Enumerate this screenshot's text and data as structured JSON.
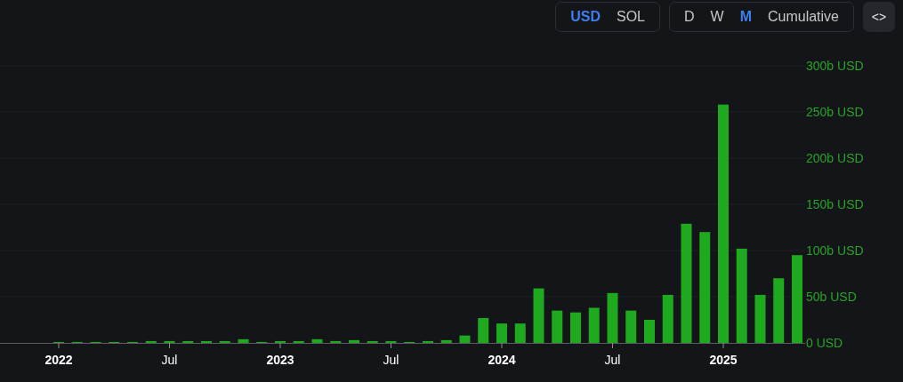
{
  "currency_toggle": [
    {
      "label": "USD",
      "selected": true
    },
    {
      "label": "SOL",
      "selected": false
    }
  ],
  "period_toggle": [
    {
      "label": "D",
      "selected": false
    },
    {
      "label": "W",
      "selected": false
    },
    {
      "label": "M",
      "selected": true
    },
    {
      "label": "Cumulative",
      "selected": false
    }
  ],
  "embed_button": {
    "label": "<>"
  },
  "chart_data": {
    "type": "bar",
    "grid": true,
    "categories": [
      "2022",
      null,
      null,
      null,
      null,
      null,
      "Jul",
      null,
      null,
      null,
      null,
      null,
      "2023",
      null,
      null,
      null,
      null,
      null,
      "Jul",
      null,
      null,
      null,
      null,
      null,
      "2024",
      null,
      null,
      null,
      null,
      null,
      "Jul",
      null,
      null,
      null,
      null,
      null,
      "2025",
      null,
      null,
      null,
      null
    ],
    "series": [
      {
        "color": "#1fa91f",
        "values": [
          1,
          1,
          1,
          1,
          1,
          2,
          2,
          2,
          2,
          2,
          4,
          1,
          2,
          2,
          4,
          2,
          3,
          2,
          2,
          1,
          2,
          3,
          8,
          27,
          21,
          21,
          59,
          35,
          33,
          38,
          54,
          35,
          25,
          52,
          129,
          120,
          258,
          102,
          52,
          70,
          95
        ]
      }
    ],
    "ylim": [
      0,
      300
    ],
    "yticks": [
      {
        "value": 0,
        "label": "0 USD"
      },
      {
        "value": 50,
        "label": "50b USD"
      },
      {
        "value": 100,
        "label": "100b USD"
      },
      {
        "value": 150,
        "label": "150b USD"
      },
      {
        "value": 200,
        "label": "200b USD"
      },
      {
        "value": 250,
        "label": "250b USD"
      },
      {
        "value": 300,
        "label": "300b USD"
      }
    ]
  }
}
